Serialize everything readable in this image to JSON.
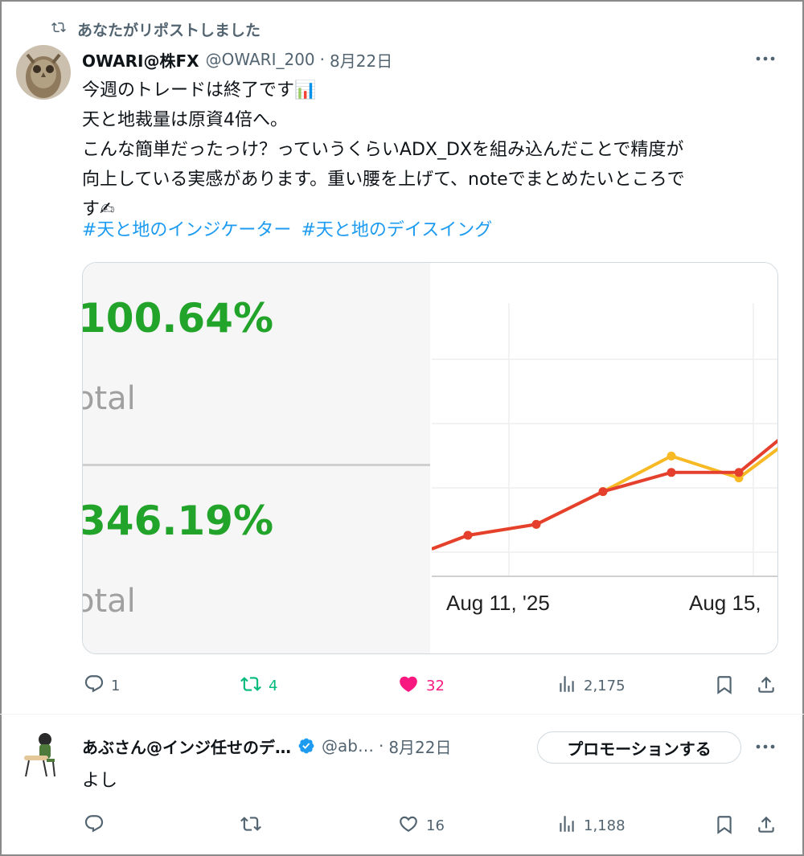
{
  "repost_notice": "あなたがリポストしました",
  "tweet": {
    "author_name": "OWARI@株FX",
    "handle": "@OWARI_200",
    "separator": "·",
    "date": "8月22日",
    "lines": [
      "今週のトレードは終了です📊",
      "天と地裁量は原資4倍へ。",
      "こんな簡単だったっけ？っていうくらいADX_DXを組み込んだことで精度が",
      "向上している実感があります。重い腰を上げて、noteでまとめたいところで",
      "す✍"
    ],
    "hashtags": [
      "#天と地のインジケーター",
      "#天と地のデイスイング"
    ],
    "media": {
      "stat1_value": "100.64%",
      "stat1_label": "otal",
      "stat2_value": "346.19%",
      "stat2_label": "otal"
    },
    "actions": {
      "replies": "1",
      "reposts": "4",
      "likes": "32",
      "views": "2,175"
    }
  },
  "chart_data": {
    "type": "line",
    "x_tick_labels": [
      "Aug 11, '25",
      "Aug 15,"
    ],
    "series": [
      {
        "color": "#f7b924",
        "values": [
          0.1,
          0.15,
          0.19,
          0.31,
          0.44,
          0.36,
          0.47
        ]
      },
      {
        "color": "#e5402e",
        "values": [
          0.1,
          0.15,
          0.19,
          0.31,
          0.38,
          0.38,
          0.5
        ]
      }
    ],
    "grid": true
  },
  "reply": {
    "author_name": "あぶさん@インジ任せのデ…",
    "handle": "@ab…",
    "separator": "·",
    "date": "8月22日",
    "promote_label": "プロモーションする",
    "text": "よし",
    "actions": {
      "replies": "",
      "reposts": "",
      "likes": "16",
      "views": "1,188"
    }
  },
  "colors": {
    "link": "#1d9bf0",
    "repost_active": "#00ba7c",
    "like_active": "#f91880",
    "muted": "#536471",
    "verified": "#1d9bf0",
    "stat_green": "#22a32a"
  }
}
